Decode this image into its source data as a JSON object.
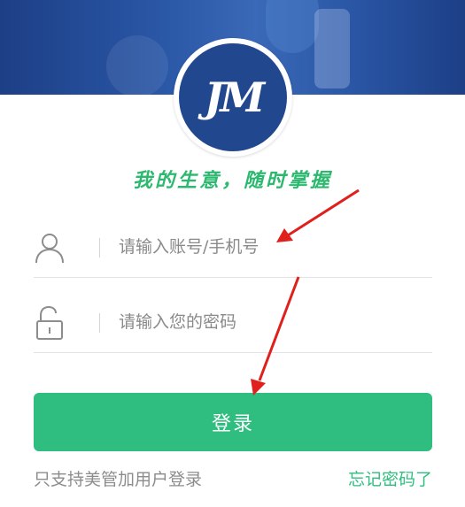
{
  "header": {
    "logo_text": "JM",
    "slogan": "我的生意，随时掌握"
  },
  "form": {
    "username": {
      "placeholder": "请输入账号/手机号",
      "icon": "user-icon"
    },
    "password": {
      "placeholder": "请输入您的密码",
      "icon": "lock-icon"
    },
    "submit_label": "登录"
  },
  "footer": {
    "note": "只支持美管加用户登录",
    "forgot_label": "忘记密码了"
  },
  "colors": {
    "brand_blue": "#21488f",
    "accent_green": "#2fbe7f",
    "arrow_red": "#e0201c"
  }
}
